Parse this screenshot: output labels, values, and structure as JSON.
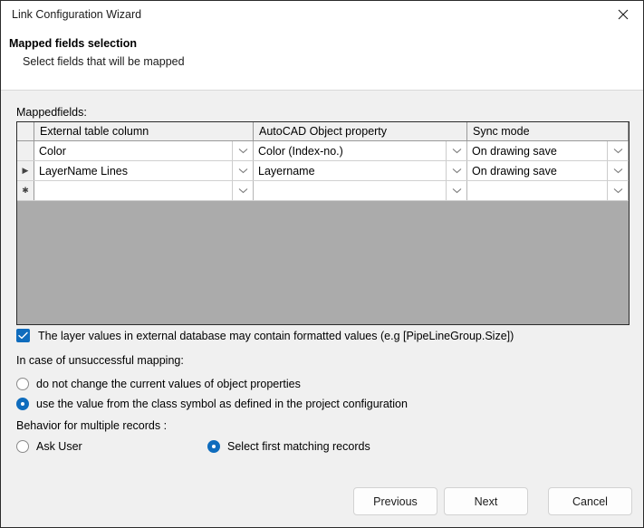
{
  "window": {
    "title": "Link Configuration Wizard",
    "close_icon": "close-icon"
  },
  "header": {
    "title": "Mapped fields selection",
    "subtitle": "Select fields that will be mapped"
  },
  "main": {
    "section_label": "Mappedfields:",
    "grid": {
      "columns": [
        "",
        "External table column",
        "AutoCAD Object property",
        "Sync mode"
      ],
      "rows": [
        {
          "indicator": "",
          "external_table_column": "Color",
          "autocad_object_property": "Color (Index-no.)",
          "sync_mode": "On drawing save"
        },
        {
          "indicator": "▶",
          "external_table_column": "LayerName Lines",
          "autocad_object_property": "Layername",
          "sync_mode": "On drawing save"
        },
        {
          "indicator": "✱",
          "external_table_column": "",
          "autocad_object_property": "",
          "sync_mode": ""
        }
      ]
    },
    "formatted_values_checkbox": {
      "label": "The layer values in external database may contain formatted values (e.g [PipeLineGroup.Size])",
      "checked": true
    },
    "unsuccessful_mapping": {
      "label": "In case of unsuccessful mapping:",
      "options": [
        {
          "label": "do not change the current values of object properties",
          "selected": false
        },
        {
          "label": "use the value from the class symbol as defined in the project configuration",
          "selected": true
        }
      ]
    },
    "multiple_records": {
      "label": "Behavior for multiple records :",
      "options": [
        {
          "label": "Ask User",
          "selected": false
        },
        {
          "label": "Select first matching records",
          "selected": true
        }
      ]
    }
  },
  "footer": {
    "previous_label": "Previous",
    "next_label": "Next",
    "cancel_label": "Cancel"
  },
  "colors": {
    "accent": "#0f6cbd",
    "grid_background": "#ababab",
    "body_background": "#f0f0f0",
    "window_border": "#2b2b2b"
  }
}
